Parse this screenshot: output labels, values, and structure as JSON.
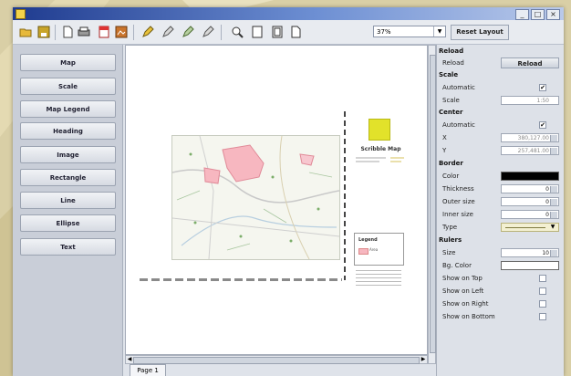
{
  "colors": {
    "background": "#d9cfa6",
    "title_bar": "#1f3b8f",
    "border_color_swatch": "#000000",
    "background_color_swatch": "#ffffff",
    "map_highlight": "#f7b7c0",
    "logo_yellow": "#e2e22a"
  },
  "window": {
    "controls": [
      "_",
      "□",
      "×"
    ]
  },
  "toolbar": {
    "icons": [
      "open-folder-icon",
      "save-icon",
      "new-page-icon",
      "print-icon",
      "pdf-export-icon",
      "image-export-icon",
      "pen-icon",
      "pen-alt-icon",
      "pen-edit-icon",
      "pen-delete-icon",
      "zoom-icon",
      "page-icon",
      "page-alt-icon",
      "page-fit-icon"
    ],
    "zoom_value": "37%",
    "reset_layout_label": "Reset Layout"
  },
  "items_panel": {
    "buttons": [
      "Map",
      "Scale",
      "Map Legend",
      "Heading",
      "Image",
      "Rectangle",
      "Line",
      "Ellipse",
      "Text"
    ]
  },
  "canvas": {
    "map_title": "Scribble Map",
    "legend_title": "Legend",
    "legend_entry": "Area",
    "page_tab": "Page 1"
  },
  "properties": {
    "reload": {
      "section": "Reload",
      "label": "Reload",
      "button_label": "Reload"
    },
    "scale": {
      "section": "Scale",
      "automatic_label": "Automatic",
      "automatic_checked": true,
      "scale_label": "Scale",
      "scale_value": "1:50"
    },
    "center": {
      "section": "Center",
      "automatic_label": "Automatic",
      "automatic_checked": true,
      "x_label": "X",
      "x_value": "380,127.00",
      "y_label": "Y",
      "y_value": "257,481.00"
    },
    "border": {
      "section": "Border",
      "color_label": "Color",
      "thickness_label": "Thickness",
      "thickness_value": "0",
      "outer_size_label": "Outer size",
      "outer_size_value": "0",
      "inner_size_label": "Inner size",
      "inner_size_value": "0",
      "type_label": "Type"
    },
    "rulers": {
      "section": "Rulers",
      "size_label": "Size",
      "size_value": "10",
      "bg_color_label": "Bg. Color",
      "show_top_label": "Show on Top",
      "show_top_checked": false,
      "show_left_label": "Show on Left",
      "show_left_checked": false,
      "show_right_label": "Show on Right",
      "show_right_checked": false,
      "show_bottom_label": "Show on Bottom",
      "show_bottom_checked": false
    }
  }
}
